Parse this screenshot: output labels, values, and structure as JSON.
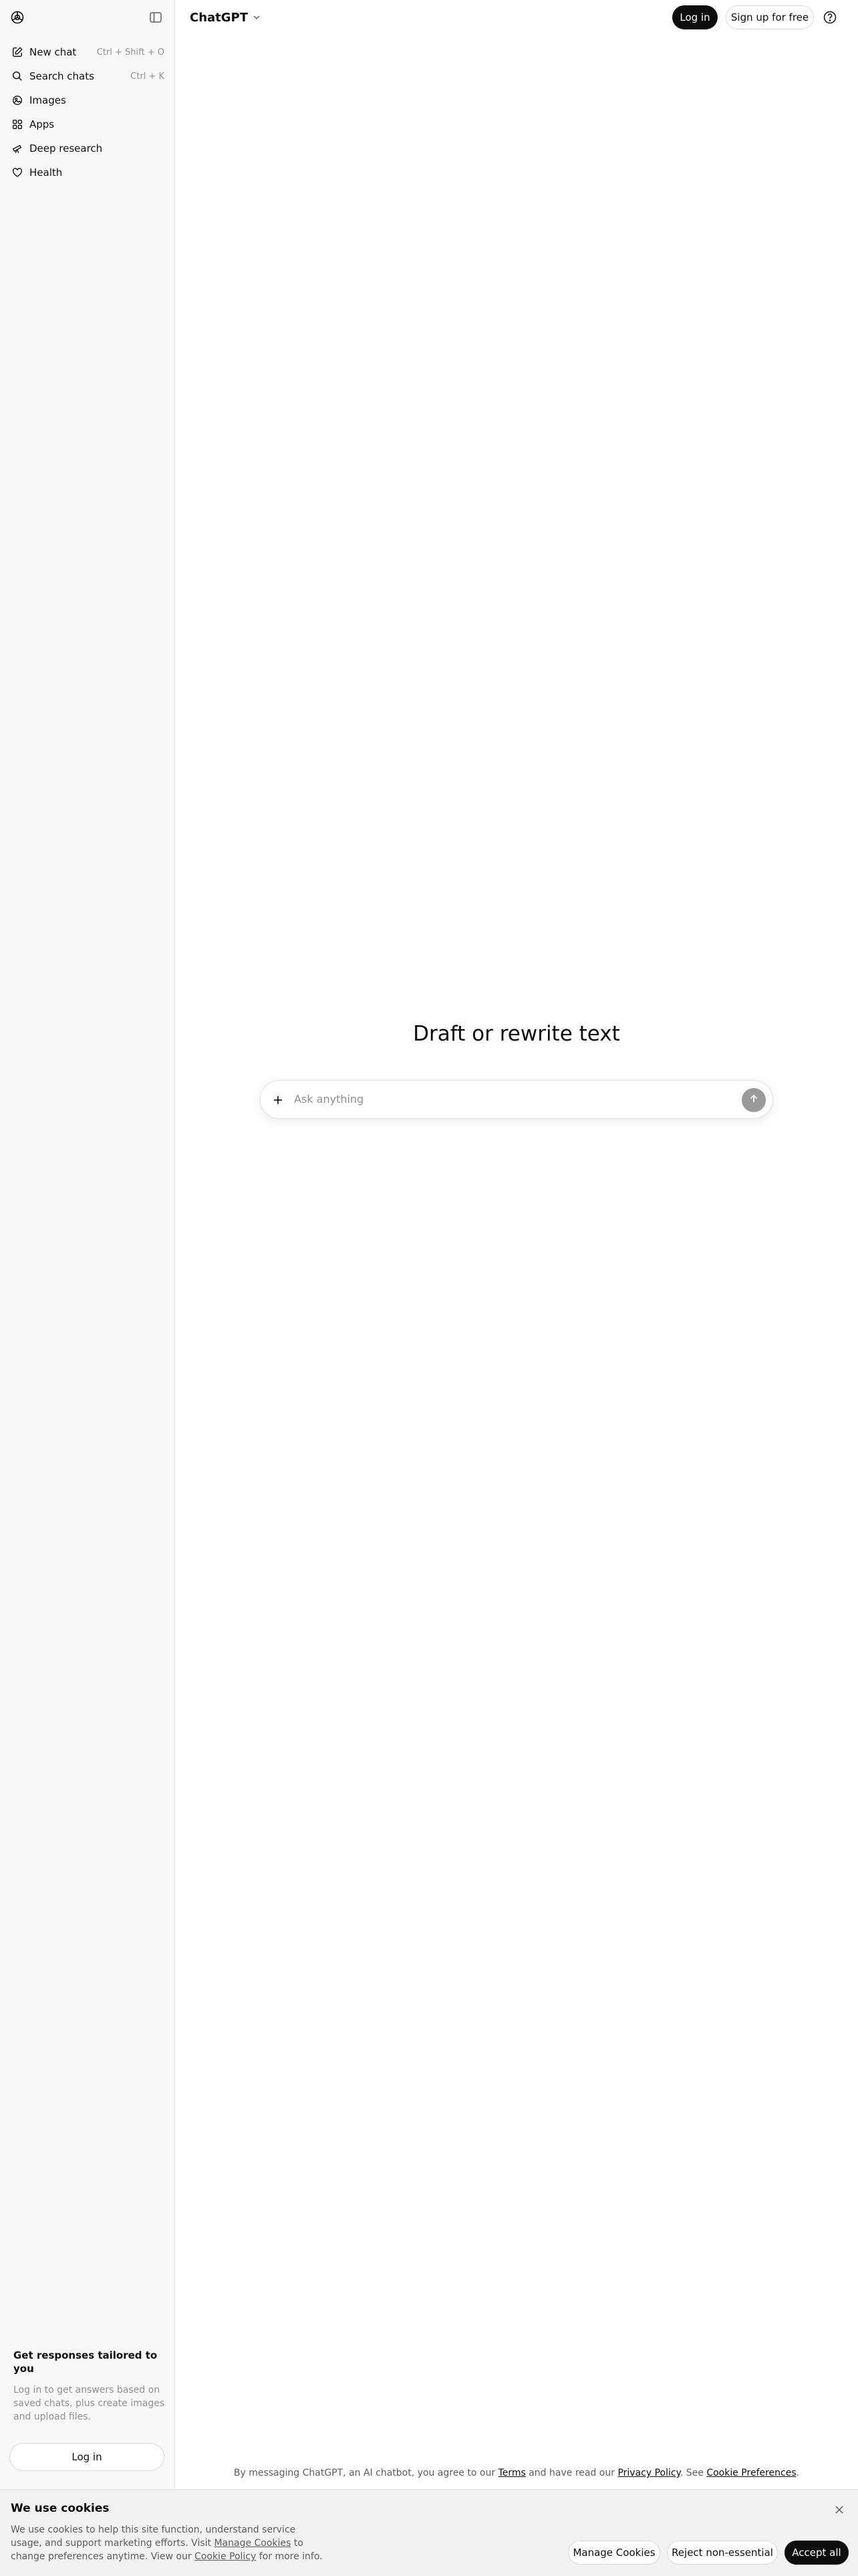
{
  "sidebar": {
    "nav": [
      {
        "label": "New chat",
        "shortcut": "Ctrl + Shift + O",
        "icon": "edit-icon"
      },
      {
        "label": "Search chats",
        "shortcut": "Ctrl + K",
        "icon": "search-icon"
      },
      {
        "label": "Images",
        "shortcut": "",
        "icon": "images-icon"
      },
      {
        "label": "Apps",
        "shortcut": "",
        "icon": "apps-icon"
      },
      {
        "label": "Deep research",
        "shortcut": "",
        "icon": "telescope-icon"
      },
      {
        "label": "Health",
        "shortcut": "",
        "icon": "heart-icon"
      }
    ],
    "promo_title": "Get responses tailored to you",
    "promo_text": "Log in to get answers based on saved chats, plus create images and upload files.",
    "login_label": "Log in"
  },
  "header": {
    "model_name": "ChatGPT",
    "login_label": "Log in",
    "signup_label": "Sign up for free"
  },
  "main": {
    "headline": "Draft or rewrite text",
    "composer_placeholder": "Ask anything"
  },
  "disclaimer": {
    "prefix": "By messaging ChatGPT, an AI chatbot, you agree to our ",
    "terms": "Terms",
    "middle": " and have read our ",
    "privacy": "Privacy Policy",
    "middle2": ". See ",
    "cookie_prefs": "Cookie Preferences",
    "suffix": "."
  },
  "cookie_banner": {
    "title": "We use cookies",
    "text_1": "We use cookies to help this site function, understand service usage, and support marketing efforts. Visit ",
    "manage_link": "Manage Cookies",
    "text_2": " to change preferences anytime. View our ",
    "policy_link": "Cookie Policy",
    "text_3": " for more info.",
    "manage_label": "Manage Cookies",
    "reject_label": "Reject non-essential",
    "accept_label": "Accept all"
  },
  "colors": {
    "sidebar_bg": "#f9f9f9",
    "primary_button": "#0d0d0d",
    "send_button": "#9a9a9a",
    "muted_text": "#8f8f8f"
  }
}
